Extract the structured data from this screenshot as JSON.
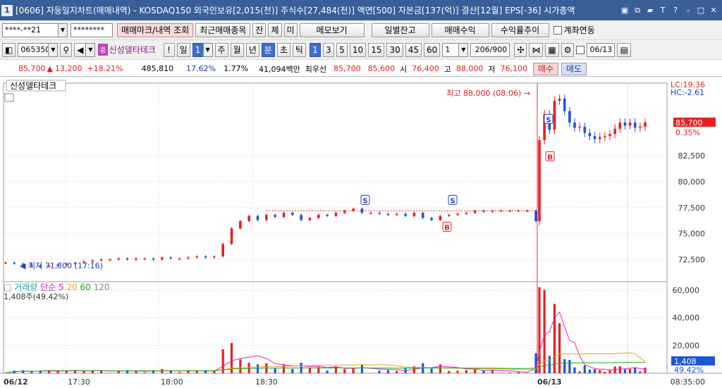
{
  "window": {
    "screen_no": "1",
    "title": "[0606] 자동일지차트(매매내역) - KOSDAQ150 외국인보유[2,015(천)] 주식수[27,484(천)] 액면[500] 자본금[137(억)] 결산[12월] EPS[-36] 시가총액"
  },
  "toolbar1": {
    "account": "****-**21",
    "password": "********",
    "mark_btn": "매매마크/내역 조회",
    "recent_btn": "최근매매종목",
    "balance_short": "잔",
    "exec_short": "체",
    "unexec_short": "미",
    "memo_btn": "메모보기",
    "daily_btn": "일별잔고",
    "profit_btn": "매매수익",
    "rate_btn": "수익률추이",
    "account_link": "계좌연동"
  },
  "toolbar2": {
    "code": "065350",
    "stock_badge": "중",
    "stock_name": "신성델타테크",
    "periods": [
      "일",
      "1",
      "주",
      "월",
      "년",
      "분",
      "초",
      "틱"
    ],
    "selected_period": "분",
    "minutes": [
      "1",
      "3",
      "5",
      "10",
      "15",
      "30",
      "45",
      "60"
    ],
    "selected_minute": "1",
    "count_sel": "1",
    "count": "206/900",
    "date": "06/13"
  },
  "quote": {
    "price": "85,700",
    "change": "13,200",
    "change_pct": "+18.21%",
    "volume": "485,810",
    "vol_ratio": "17.62%",
    "turnover": "1.77%",
    "amount": "41,094백만",
    "best_label": "최우선",
    "ask": "85,700",
    "bid": "85,600",
    "open_label": "시",
    "open": "76,400",
    "high_label": "고",
    "high": "88,000",
    "low_label": "저",
    "low": "76,100",
    "buy_btn": "매수",
    "sell_btn": "매도"
  },
  "chart_data": {
    "type": "candlestick",
    "stock_label": "신성델타테크",
    "x_labels": [
      "06/12",
      "17:30",
      "18:00",
      "18:30",
      "06/13",
      "08:35:00"
    ],
    "y_ticks": [
      "82,500",
      "80,000",
      "77,500",
      "75,000",
      "72,500"
    ],
    "y_range": [
      70500,
      89500
    ],
    "max_label": "최고 88,000 (08:06)",
    "min_label": "최저 71,800 (17:16)",
    "lc": "LC:19.36",
    "hc": "HC:-2.61",
    "current_price": "85,700",
    "current_pct": "0.35%",
    "price_series": [
      72200,
      72100,
      72000,
      71900,
      71800,
      71900,
      72000,
      72100,
      72200,
      72300,
      72400,
      72500,
      72500,
      72600,
      72500,
      72600,
      72600,
      72500,
      72700,
      72600,
      72600,
      72700,
      72800,
      72700,
      72800,
      74000,
      75500,
      76200,
      76700,
      76300,
      76800,
      76600,
      77000,
      76800,
      76300,
      76500,
      76800,
      76700,
      77000,
      77200,
      77400,
      77000,
      77000,
      76900,
      76800,
      76900,
      76700,
      77000,
      76500,
      76300,
      76700,
      76800,
      76900,
      77000,
      77200,
      77100,
      77200,
      77200,
      77200,
      77200,
      77200,
      76200,
      84000,
      86500,
      85000,
      87800,
      88000,
      86800,
      85700,
      85200,
      85300,
      84700,
      84400,
      84100,
      84300,
      84400,
      84600,
      85100,
      85700,
      85400,
      85700,
      85200,
      85300,
      85700
    ],
    "markers": [
      {
        "type": "S",
        "price": 77400
      },
      {
        "type": "S",
        "price": 77400
      },
      {
        "type": "B",
        "price": 76300
      },
      {
        "type": "S",
        "price": 85200
      },
      {
        "type": "B",
        "price": 83100
      }
    ],
    "volume_label": "거래량",
    "ma_label": "단순",
    "ma_periods": [
      "5",
      "20",
      "60",
      "120"
    ],
    "ma_colors": [
      "#e020c8",
      "#f0a000",
      "#20a020",
      "#888888"
    ],
    "volume_note": "1,408주(49.42%)",
    "vol_ticks": [
      "60,000",
      "40,000",
      "20,000"
    ],
    "vol_current": "1,408",
    "vol_pct": "49.42%"
  }
}
